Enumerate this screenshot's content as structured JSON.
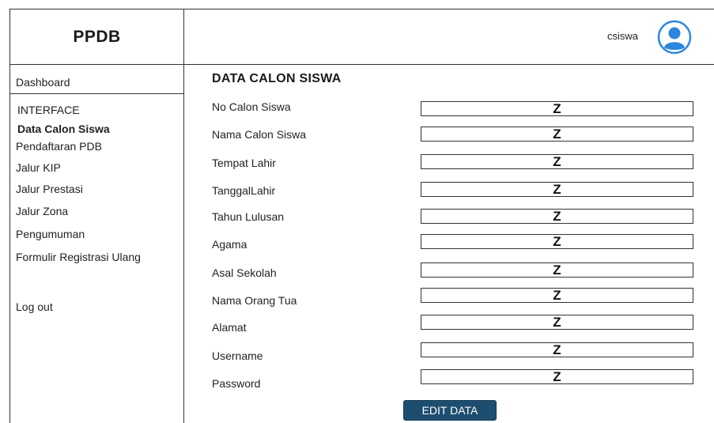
{
  "brand": {
    "title": "PPDB"
  },
  "header": {
    "username": "csiswa",
    "avatar_icon": "user-circle-icon",
    "avatar_color": "#2e86de"
  },
  "sidebar": {
    "dashboard": "Dashboard",
    "section_heading": "INTERFACE",
    "items": [
      "Data Calon Siswa",
      "Pendaftaran PDB",
      "Jalur KIP",
      "Jalur Prestasi",
      "Jalur Zona",
      "Pengumuman",
      "Formulir Registrasi Ulang"
    ],
    "logout": "Log out"
  },
  "main": {
    "title": "DATA CALON SISWA",
    "fields": [
      {
        "label": "No Calon Siswa",
        "value": "Z"
      },
      {
        "label": "Nama Calon Siswa",
        "value": "Z"
      },
      {
        "label": "Tempat Lahir",
        "value": "Z"
      },
      {
        "label": "TanggalLahir",
        "value": "Z"
      },
      {
        "label": "Tahun Lulusan",
        "value": "Z"
      },
      {
        "label": "Agama",
        "value": "Z"
      },
      {
        "label": "Asal Sekolah",
        "value": "Z"
      },
      {
        "label": "Nama Orang Tua",
        "value": "Z"
      },
      {
        "label": "Alamat",
        "value": "Z"
      },
      {
        "label": "Username",
        "value": "Z"
      },
      {
        "label": "Password",
        "value": "Z"
      }
    ],
    "edit_button": "EDIT DATA",
    "button_color": "#1e4e6f"
  }
}
